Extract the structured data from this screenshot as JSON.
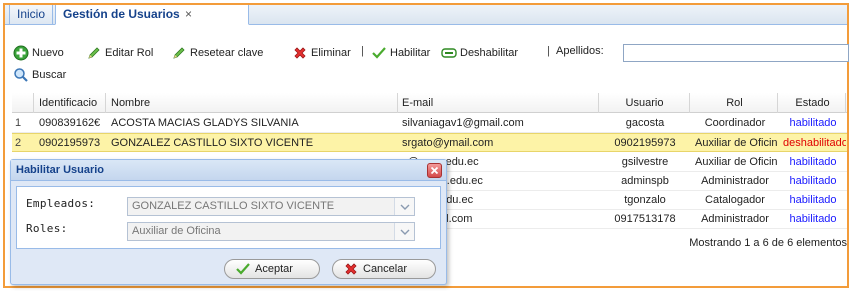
{
  "tabs": [
    {
      "label": "Inicio"
    },
    {
      "label": "Gestión de Usuarios",
      "close": "×"
    }
  ],
  "toolbar": {
    "nuevo": "Nuevo",
    "editar_rol": "Editar Rol",
    "resetear_clave": "Resetear clave",
    "eliminar": "Eliminar",
    "sep1": "|",
    "habilitar": "Habilitar",
    "deshabilitar": "Deshabilitar",
    "sep2": "|",
    "apellidos_label": "Apellidos:",
    "apellidos_value": "",
    "buscar": "Buscar"
  },
  "grid": {
    "columns": [
      "Identificacio",
      "Nombre",
      "E-mail",
      "Usuario",
      "Rol",
      "Estado"
    ],
    "rows": [
      {
        "num": "1",
        "id": "090839162€",
        "nombre": "ACOSTA MACIAS GLADYS SILVANIA",
        "email": "silvaniagav1@gmail.com",
        "usuario": "gacosta",
        "rol": "Coordinador",
        "estado": "habilitado"
      },
      {
        "num": "2",
        "id": "0902195973",
        "nombre": "GONZALEZ CASTILLO SIXTO VICENTE",
        "email": "srgato@ymail.com",
        "usuario": "0902195973",
        "rol": "Auxiliar de Oficina",
        "estado": "deshabilitado"
      },
      {
        "num": "",
        "id": "",
        "nombre": "",
        "email": "z@upse.edu.ec",
        "usuario": "gsilvestre",
        "rol": "Auxiliar de Oficina",
        "estado": "habilitado"
      },
      {
        "num": "",
        "id": "",
        "nombre": "",
        "email": "er@upse.edu.ec",
        "usuario": "adminspb",
        "rol": "Administrador",
        "estado": "habilitado"
      },
      {
        "num": "",
        "id": "",
        "nombre": "",
        "email": "@upse.edu.ec",
        "usuario": "tgonzalo",
        "rol": "Catalogador",
        "estado": "habilitado"
      },
      {
        "num": "",
        "id": "",
        "nombre": "",
        "email": "@hotmail.com",
        "usuario": "0917513178",
        "rol": "Administrador",
        "estado": "habilitado"
      }
    ],
    "footer": "Mostrando 1 a 6 de 6 elementos"
  },
  "dialog": {
    "title": "Habilitar Usuario",
    "empleados_label": "Empleados:",
    "empleados_value": "GONZALEZ CASTILLO SIXTO VICENTE",
    "roles_label": "Roles:",
    "roles_value": "Auxiliar de Oficina",
    "aceptar": "Aceptar",
    "cancelar": "Cancelar"
  },
  "colors": {
    "frame_border": "#f39c3a",
    "selected_row": "#fdf3a7",
    "habilitado": "#1a1aff",
    "deshabilitado": "#e00000",
    "header_blue": "#15428b"
  },
  "icons": {
    "nuevo": "plus-icon",
    "editar_rol": "pencil-icon",
    "resetear_clave": "pencil-icon",
    "eliminar": "red-x-icon",
    "habilitar": "checkmark-icon",
    "deshabilitar": "minus-icon",
    "buscar": "magnifier-icon"
  }
}
